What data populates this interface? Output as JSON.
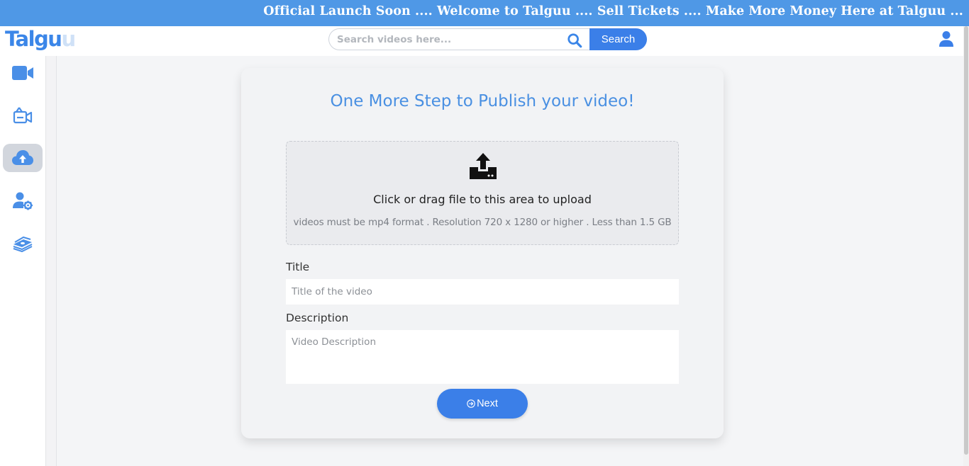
{
  "announcement": {
    "text": "Official Launch Soon .... Welcome to Talguu .... Sell Tickets .... Make More Money Here at Talguu ..."
  },
  "header": {
    "logo_main": "Talgu",
    "logo_faded": "u",
    "search": {
      "placeholder": "Search videos here...",
      "value": "",
      "button_label": "Search",
      "icon": "search-icon"
    },
    "user_icon": "user-icon"
  },
  "sidebar": {
    "items": [
      {
        "icon": "video-camera-icon",
        "active": false
      },
      {
        "icon": "camera-list-icon",
        "active": false
      },
      {
        "icon": "cloud-upload-icon",
        "active": true
      },
      {
        "icon": "user-settings-icon",
        "active": false
      },
      {
        "icon": "money-stack-icon",
        "active": false
      }
    ]
  },
  "main": {
    "title": "One More Step to Publish your video!",
    "dropzone": {
      "icon": "upload-icon",
      "main_text": "Click or drag file to this area to upload",
      "sub_text": "videos must be mp4 format . Resolution 720 x 1280 or higher . Less than 1.5 GB"
    },
    "title_field": {
      "label": "Title",
      "placeholder": "Title of the video",
      "value": ""
    },
    "description_field": {
      "label": "Description",
      "placeholder": "Video Description",
      "value": ""
    },
    "next_button": {
      "label": "Next",
      "icon": "arrow-circle-right-icon"
    }
  },
  "colors": {
    "accent": "#3b7fe8",
    "banner": "#4f98e6",
    "title": "#4a90e2"
  }
}
